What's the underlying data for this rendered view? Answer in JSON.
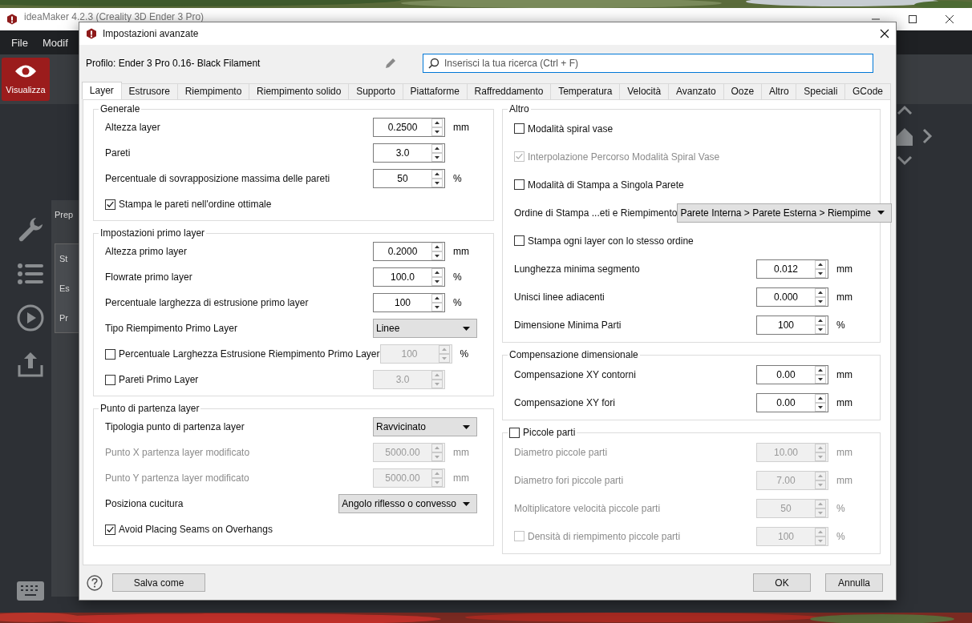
{
  "app": {
    "title": "ideaMaker 4.2.3 (Creality 3D Ender 3 Pro)",
    "menu": [
      "File",
      "Modif"
    ],
    "toolbar_button": "Visualizza",
    "panel_title": "Prep",
    "panel_items": [
      "St",
      "Es",
      "Pr"
    ]
  },
  "dialog": {
    "title": "Impostazioni avanzate",
    "profile": "Profilo: Ender 3 Pro 0.16- Black Filament",
    "search": {
      "placeholder": "Inserisci la tua ricerca (Ctrl + F)"
    },
    "tabs": [
      {
        "label": "Layer",
        "selected": true
      },
      {
        "label": "Estrusore",
        "selected": false
      },
      {
        "label": "Riempimento",
        "selected": false
      },
      {
        "label": "Riempimento solido",
        "selected": false
      },
      {
        "label": "Supporto",
        "selected": false
      },
      {
        "label": "Piattaforme",
        "selected": false
      },
      {
        "label": "Raffreddamento",
        "selected": false
      },
      {
        "label": "Temperatura",
        "selected": false
      },
      {
        "label": "Velocità",
        "selected": false
      },
      {
        "label": "Avanzato",
        "selected": false
      },
      {
        "label": "Ooze",
        "selected": false
      },
      {
        "label": "Altro",
        "selected": false
      },
      {
        "label": "Speciali",
        "selected": false
      },
      {
        "label": "GCode",
        "selected": false
      }
    ],
    "columns": [
      {
        "groups": [
          {
            "title": "Generale",
            "rows": [
              {
                "kind": "spin",
                "label": "Altezza layer",
                "value": "0.2500",
                "unit": "mm"
              },
              {
                "kind": "spin",
                "label": "Pareti",
                "value": "3.0"
              },
              {
                "kind": "spin",
                "label": "Percentuale di sovrapposizione massima delle pareti",
                "value": "50",
                "unit": "%"
              },
              {
                "kind": "check",
                "label": "Stampa le pareti nell'ordine ottimale",
                "checked": true
              }
            ]
          },
          {
            "title": "Impostazioni primo layer",
            "rows": [
              {
                "kind": "spin",
                "label": "Altezza primo layer",
                "value": "0.2000",
                "unit": "mm"
              },
              {
                "kind": "spin",
                "label": "Flowrate primo layer",
                "value": "100.0",
                "unit": "%"
              },
              {
                "kind": "spin",
                "label": "Percentuale larghezza di estrusione primo layer",
                "value": "100",
                "unit": "%"
              },
              {
                "kind": "combo",
                "label": "Tipo Riempimento Primo Layer",
                "value": "Linee"
              },
              {
                "kind": "check_spin",
                "label": "Percentuale Larghezza Estrusione Riempimento Primo Layer",
                "checked": false,
                "value": "100",
                "unit": "%"
              },
              {
                "kind": "check_spin",
                "label": "Pareti Primo Layer",
                "checked": false,
                "value": "3.0"
              }
            ]
          },
          {
            "title": "Punto di partenza layer",
            "rows": [
              {
                "kind": "combo",
                "label": "Tipologia punto di partenza layer",
                "value": "Ravvicinato"
              },
              {
                "kind": "spin",
                "label": "Punto X partenza layer modificato",
                "value": "5000.00",
                "unit": "mm",
                "disabled": true
              },
              {
                "kind": "spin",
                "label": "Punto Y partenza layer modificato",
                "value": "5000.00",
                "unit": "mm",
                "disabled": true
              },
              {
                "kind": "combo",
                "label": "Posiziona cucitura",
                "value": "Angolo riflesso o convesso"
              },
              {
                "kind": "check",
                "label": "Avoid Placing Seams on Overhangs",
                "checked": true
              }
            ]
          }
        ]
      },
      {
        "groups": [
          {
            "title": "Altro",
            "rows": [
              {
                "kind": "check",
                "label": "Modalità spiral vase",
                "checked": false
              },
              {
                "kind": "check",
                "label": "Interpolazione Percorso Modalità Spiral Vase",
                "checked": true,
                "disabled": true
              },
              {
                "kind": "check",
                "label": "Modalità di Stampa a Singola Parete",
                "checked": false
              },
              {
                "kind": "combo",
                "label": "Ordine di Stampa ...eti e Riempimento",
                "value": "Parete Interna > Parete Esterna > Riempime"
              },
              {
                "kind": "check",
                "label": "Stampa ogni layer con lo stesso ordine",
                "checked": false
              },
              {
                "kind": "spin",
                "label": "Lunghezza minima segmento",
                "value": "0.012",
                "unit": "mm"
              },
              {
                "kind": "spin",
                "label": "Unisci linee adiacenti",
                "value": "0.000",
                "unit": "mm"
              },
              {
                "kind": "spin",
                "label": "Dimensione Minima Parti",
                "value": "100",
                "unit": "%"
              }
            ]
          },
          {
            "title": "Compensazione dimensionale",
            "rows": [
              {
                "kind": "spin",
                "label": "Compensazione XY contorni",
                "value": "0.00",
                "unit": "mm"
              },
              {
                "kind": "spin",
                "label": "Compensazione XY fori",
                "value": "0.00",
                "unit": "mm"
              }
            ]
          },
          {
            "title": "Piccole parti",
            "checked": false,
            "rows": [
              {
                "kind": "spin",
                "label": "Diametro piccole parti",
                "value": "10.00",
                "unit": "mm"
              },
              {
                "kind": "spin",
                "label": "Diametro fori piccole parti",
                "value": "7.00",
                "unit": "mm"
              },
              {
                "kind": "spin",
                "label": "Moltiplicatore velocità piccole parti",
                "value": "50",
                "unit": "%"
              },
              {
                "kind": "check_spin",
                "label": "Densità di riempimento piccole parti",
                "checked": false,
                "value": "100",
                "unit": "%"
              }
            ]
          }
        ]
      }
    ],
    "left_buttons": [
      "Salva come"
    ],
    "right_buttons": [
      "OK",
      "Annulla"
    ]
  }
}
